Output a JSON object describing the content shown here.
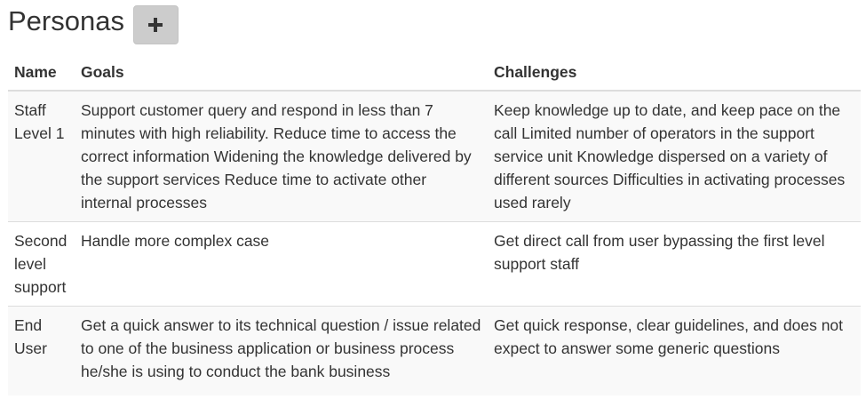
{
  "header": {
    "title": "Personas",
    "add_button_icon": "plus-icon"
  },
  "table": {
    "columns": [
      "Name",
      "Goals",
      "Challenges"
    ],
    "rows": [
      {
        "name": "Staff Level 1",
        "goals": "Support customer query and respond in less than 7 minutes with high reliability. Reduce time to access the correct information Widening the knowledge delivered by the support services Reduce time to activate other internal processes",
        "challenges": "Keep knowledge up to date, and keep pace on the call Limited number of operators in the support service unit Knowledge dispersed on a variety of different sources Difficulties in activating processes used rarely"
      },
      {
        "name": "Second level support",
        "goals": "Handle more complex case",
        "challenges": "Get direct call from user bypassing the first level support staff"
      },
      {
        "name": "End User",
        "goals": "Get a quick answer to its technical question / issue related to one of the business application or business process he/she is using to conduct the bank business",
        "challenges": "Get quick response, clear guidelines, and does not expect to answer some generic questions"
      }
    ]
  }
}
